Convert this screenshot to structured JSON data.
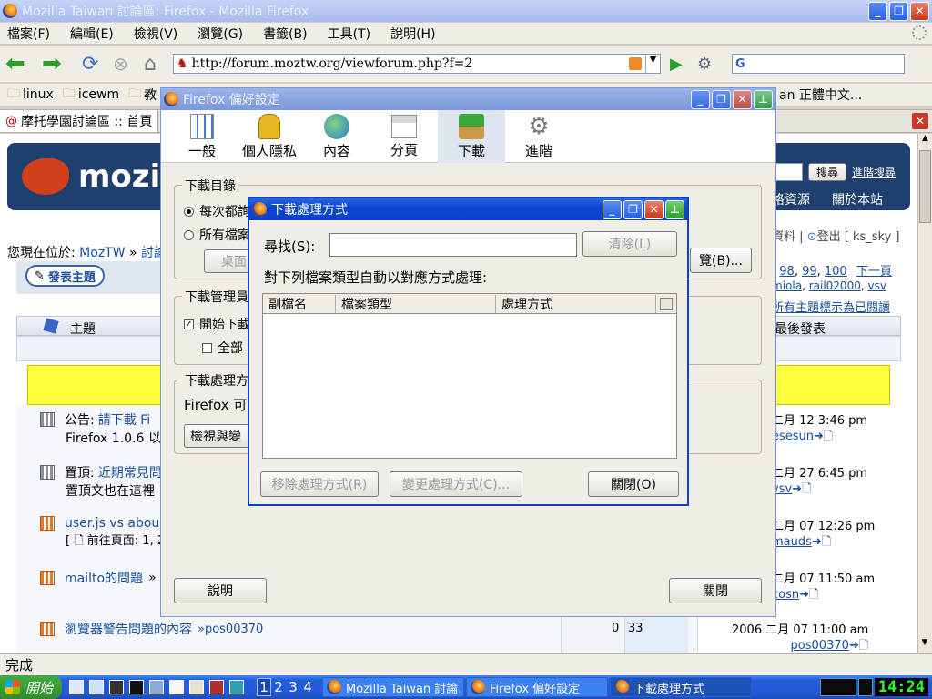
{
  "firefox": {
    "title": "Mozilla Taiwan 討論區: Firefox - Mozilla Firefox",
    "menus": [
      "檔案(F)",
      "編輯(E)",
      "檢視(V)",
      "瀏覽(G)",
      "書籤(B)",
      "工具(T)",
      "說明(H)"
    ],
    "url": "http://forum.moztw.org/viewforum.php?f=2",
    "search_prefix": "G",
    "bookmarks": [
      "linux",
      "icewm",
      "教"
    ],
    "bookmark_right": "an 正體中文...",
    "tab_title": "摩托學園討論區 :: 首頁",
    "status": "完成"
  },
  "forum": {
    "logo_text": "mozil",
    "search_btn": "搜尋",
    "adv_search": "進階搜尋",
    "nav_resources": "格資源",
    "nav_about": "關於本站",
    "user_links": {
      "profile": "資料",
      "logout": "登出",
      "user": "[ ks_sky ]"
    },
    "breadcrumb_prefix": "您現在位於:",
    "breadcrumb_home": "MozTW",
    "breadcrumb_sep": "»",
    "breadcrumb_forum": "討論",
    "new_topic": "發表主題",
    "pages": [
      "98",
      "99",
      "100"
    ],
    "next_page": "下一頁",
    "moderators": [
      "miola",
      "rail02000",
      "vsv"
    ],
    "mark_read": "所有主題標示為已閱讀",
    "col_topic": "主題",
    "col_last": "最後發表",
    "rows": [
      {
        "prefix": "公告:",
        "title": "請下載 Fi",
        "line2": "Firefox 1.0.6 以",
        "date": "二月 12 3:46 pm",
        "user": "esesun"
      },
      {
        "prefix": "置頂:",
        "title": "近期常見問",
        "line2": "置頂文也在這裡",
        "date": "二月 27 6:45 pm",
        "user": "vsv"
      },
      {
        "prefix": "",
        "title": "user.js vs abou",
        "line2": "[ 🗋 前往頁面: 1, 2",
        "date": "二月 07 12:26 pm",
        "user": "mauds"
      },
      {
        "prefix": "",
        "title": "mailto的問題",
        "suffix": "»",
        "line2": "",
        "date": "二月 07 11:50 am",
        "user": "cosn"
      },
      {
        "prefix": "",
        "title": "瀏覽器警告問題的內容",
        "suffix": "»pos00370",
        "line2": "",
        "date": "2006 二月 07 11:00 am",
        "user": "pos00370",
        "replies": "0",
        "views": "33"
      }
    ]
  },
  "prefs": {
    "title": "Firefox 偏好設定",
    "tabs": [
      "一般",
      "個人隱私",
      "內容",
      "分頁",
      "下載",
      "進階"
    ],
    "selected_tab": "下載",
    "download_dir_legend": "下載目錄",
    "radio1": "每次都詢",
    "radio2": "所有檔案",
    "desktop_btn": "桌面",
    "browse_btn": "覽(B)...",
    "dm_legend": "下載管理員",
    "dm_check1": "開始下載",
    "dm_check2": "全部",
    "dp_legend": "下載處理方",
    "dp_text": "Firefox 可",
    "view_btn": "檢視與變",
    "help_btn": "說明",
    "close_btn": "關閉"
  },
  "dialog": {
    "title": "下載處理方式",
    "find_label": "尋找(S):",
    "find_value": "",
    "clear_btn": "清除(L)",
    "desc": "對下列檔案類型自動以對應方式處理:",
    "col_ext": "副檔名",
    "col_type": "檔案類型",
    "col_action": "處理方式",
    "remove_btn": "移除處理方式(R)",
    "change_btn": "變更處理方式(C)...",
    "close_btn": "關閉(O)"
  },
  "taskbar": {
    "start": "開始",
    "desktops": [
      "1",
      "2",
      "3",
      "4"
    ],
    "tasks": [
      "Mozilla Taiwan 討論...",
      "Firefox 偏好設定",
      "下載處理方式"
    ],
    "clock": "14:24"
  }
}
